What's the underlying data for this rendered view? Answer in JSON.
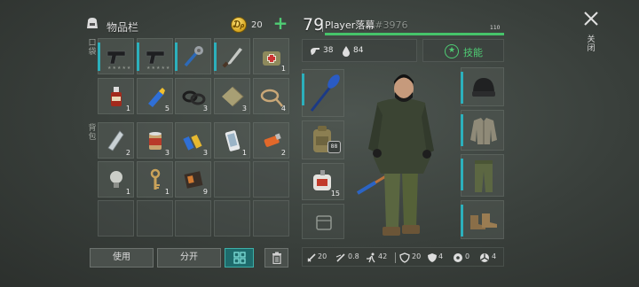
{
  "inventory": {
    "title": "物品栏",
    "coins": "20",
    "plus": "+",
    "tab_pockets": "口袋",
    "tab_backpack": "背包",
    "pocket_items": [
      {
        "icon": "pistol-icon",
        "qty": "",
        "stars": "★★★★★"
      },
      {
        "icon": "pistol-icon",
        "qty": "",
        "stars": "★★★★★"
      },
      {
        "icon": "spiked-club-icon",
        "qty": "",
        "stars": ""
      },
      {
        "icon": "machete-icon",
        "qty": "",
        "stars": ""
      },
      {
        "icon": "first-aid-bag-icon",
        "qty": "1",
        "stars": ""
      },
      {
        "icon": "bottle-icon",
        "qty": "1",
        "stars": ""
      },
      {
        "icon": "glue-icon",
        "qty": "5",
        "stars": ""
      },
      {
        "icon": "rubber-ring-icon",
        "qty": "3",
        "stars": ""
      },
      {
        "icon": "cloth-icon",
        "qty": "3",
        "stars": ""
      },
      {
        "icon": "rope-icon",
        "qty": "4",
        "stars": ""
      }
    ],
    "backpack_items": [
      {
        "icon": "water-bottle-icon",
        "qty": "2"
      },
      {
        "icon": "canned-food-icon",
        "qty": "3"
      },
      {
        "icon": "batteries-icon",
        "qty": "3"
      },
      {
        "icon": "phone-icon",
        "qty": "1"
      },
      {
        "icon": "usb-drive-icon",
        "qty": "2"
      },
      {
        "icon": "light-bulb-icon",
        "qty": "1"
      },
      {
        "icon": "key-icon",
        "qty": "1"
      },
      {
        "icon": "book-icon",
        "qty": "9"
      }
    ],
    "buttons": {
      "use": "使用",
      "split": "分开"
    }
  },
  "player": {
    "level": "79",
    "name": "Player落幕",
    "id": "#3976",
    "xp_value": "110",
    "xp_fraction": 1.0,
    "hunger": "38",
    "water": "84",
    "skills_label": "技能",
    "weapon_qty": "15",
    "backpack_badge": "88"
  },
  "stats": {
    "damage": "20",
    "attack_speed": "0.8",
    "move": "42",
    "defense": "20",
    "armor": "4",
    "resist_a": "0",
    "resist_b": "4"
  },
  "close_label": "关闭",
  "colors": {
    "accent_teal": "#2cb0bc",
    "accent_green": "#4fcc74",
    "xp_green": "#46c46a"
  }
}
